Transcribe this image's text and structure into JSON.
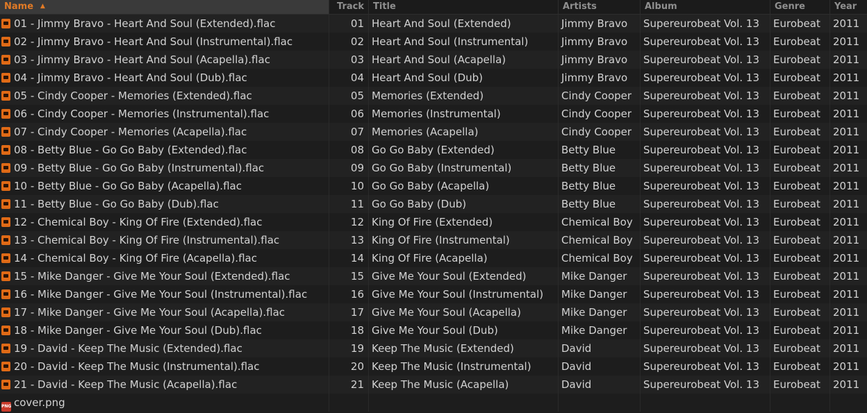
{
  "header": {
    "name": "Name",
    "track": "Track",
    "title": "Title",
    "artists": "Artists",
    "album": "Album",
    "genre": "Genre",
    "year": "Year",
    "sort_column": "Name",
    "sort_direction": "ascending",
    "sort_icon": "sort-up-icon"
  },
  "accent_color": "#e07a26",
  "files": [
    {
      "name": "01 - Jimmy Bravo - Heart And Soul (Extended).flac",
      "track": "01",
      "title": "Heart And Soul (Extended)",
      "artist": "Jimmy Bravo",
      "album": "Supereurobeat Vol. 13",
      "genre": "Eurobeat",
      "year": "2011"
    },
    {
      "name": "02 - Jimmy Bravo - Heart And Soul (Instrumental).flac",
      "track": "02",
      "title": "Heart And Soul (Instrumental)",
      "artist": "Jimmy Bravo",
      "album": "Supereurobeat Vol. 13",
      "genre": "Eurobeat",
      "year": "2011"
    },
    {
      "name": "03 - Jimmy Bravo - Heart And Soul (Acapella).flac",
      "track": "03",
      "title": "Heart And Soul (Acapella)",
      "artist": "Jimmy Bravo",
      "album": "Supereurobeat Vol. 13",
      "genre": "Eurobeat",
      "year": "2011"
    },
    {
      "name": "04 - Jimmy Bravo - Heart And Soul (Dub).flac",
      "track": "04",
      "title": "Heart And Soul (Dub)",
      "artist": "Jimmy Bravo",
      "album": "Supereurobeat Vol. 13",
      "genre": "Eurobeat",
      "year": "2011"
    },
    {
      "name": "05 - Cindy Cooper - Memories (Extended).flac",
      "track": "05",
      "title": "Memories (Extended)",
      "artist": "Cindy Cooper",
      "album": "Supereurobeat Vol. 13",
      "genre": "Eurobeat",
      "year": "2011"
    },
    {
      "name": "06 - Cindy Cooper - Memories (Instrumental).flac",
      "track": "06",
      "title": "Memories (Instrumental)",
      "artist": "Cindy Cooper",
      "album": "Supereurobeat Vol. 13",
      "genre": "Eurobeat",
      "year": "2011"
    },
    {
      "name": "07 - Cindy Cooper - Memories (Acapella).flac",
      "track": "07",
      "title": "Memories (Acapella)",
      "artist": "Cindy Cooper",
      "album": "Supereurobeat Vol. 13",
      "genre": "Eurobeat",
      "year": "2011"
    },
    {
      "name": "08 - Betty Blue - Go Go Baby (Extended).flac",
      "track": "08",
      "title": "Go Go Baby (Extended)",
      "artist": "Betty Blue",
      "album": "Supereurobeat Vol. 13",
      "genre": "Eurobeat",
      "year": "2011"
    },
    {
      "name": "09 - Betty Blue - Go Go Baby (Instrumental).flac",
      "track": "09",
      "title": "Go Go Baby (Instrumental)",
      "artist": "Betty Blue",
      "album": "Supereurobeat Vol. 13",
      "genre": "Eurobeat",
      "year": "2011"
    },
    {
      "name": "10 - Betty Blue - Go Go Baby (Acapella).flac",
      "track": "10",
      "title": "Go Go Baby (Acapella)",
      "artist": "Betty Blue",
      "album": "Supereurobeat Vol. 13",
      "genre": "Eurobeat",
      "year": "2011"
    },
    {
      "name": "11 - Betty Blue - Go Go Baby (Dub).flac",
      "track": "11",
      "title": "Go Go Baby (Dub)",
      "artist": "Betty Blue",
      "album": "Supereurobeat Vol. 13",
      "genre": "Eurobeat",
      "year": "2011"
    },
    {
      "name": "12 - Chemical Boy - King Of Fire (Extended).flac",
      "track": "12",
      "title": "King Of Fire (Extended)",
      "artist": "Chemical Boy",
      "album": "Supereurobeat Vol. 13",
      "genre": "Eurobeat",
      "year": "2011"
    },
    {
      "name": "13 - Chemical Boy - King Of Fire (Instrumental).flac",
      "track": "13",
      "title": "King Of Fire (Instrumental)",
      "artist": "Chemical Boy",
      "album": "Supereurobeat Vol. 13",
      "genre": "Eurobeat",
      "year": "2011"
    },
    {
      "name": "14 - Chemical Boy - King Of Fire (Acapella).flac",
      "track": "14",
      "title": "King Of Fire (Acapella)",
      "artist": "Chemical Boy",
      "album": "Supereurobeat Vol. 13",
      "genre": "Eurobeat",
      "year": "2011"
    },
    {
      "name": "15 - Mike Danger - Give Me Your Soul (Extended).flac",
      "track": "15",
      "title": "Give Me Your Soul (Extended)",
      "artist": "Mike Danger",
      "album": "Supereurobeat Vol. 13",
      "genre": "Eurobeat",
      "year": "2011"
    },
    {
      "name": "16 - Mike Danger - Give Me Your Soul (Instrumental).flac",
      "track": "16",
      "title": "Give Me Your Soul (Instrumental)",
      "artist": "Mike Danger",
      "album": "Supereurobeat Vol. 13",
      "genre": "Eurobeat",
      "year": "2011"
    },
    {
      "name": "17 - Mike Danger - Give Me Your Soul (Acapella).flac",
      "track": "17",
      "title": "Give Me Your Soul (Acapella)",
      "artist": "Mike Danger",
      "album": "Supereurobeat Vol. 13",
      "genre": "Eurobeat",
      "year": "2011"
    },
    {
      "name": "18 - Mike Danger - Give Me Your Soul (Dub).flac",
      "track": "18",
      "title": "Give Me Your Soul (Dub)",
      "artist": "Mike Danger",
      "album": "Supereurobeat Vol. 13",
      "genre": "Eurobeat",
      "year": "2011"
    },
    {
      "name": "19 - David - Keep The Music (Extended).flac",
      "track": "19",
      "title": "Keep The Music (Extended)",
      "artist": "David",
      "album": "Supereurobeat Vol. 13",
      "genre": "Eurobeat",
      "year": "2011"
    },
    {
      "name": "20 - David - Keep The Music (Instrumental).flac",
      "track": "20",
      "title": "Keep The Music (Instrumental)",
      "artist": "David",
      "album": "Supereurobeat Vol. 13",
      "genre": "Eurobeat",
      "year": "2011"
    },
    {
      "name": "21 - David - Keep The Music (Acapella).flac",
      "track": "21",
      "title": "Keep The Music (Acapella)",
      "artist": "David",
      "album": "Supereurobeat Vol. 13",
      "genre": "Eurobeat",
      "year": "2011"
    },
    {
      "name": "cover.png",
      "track": "",
      "title": "",
      "artist": "",
      "album": "",
      "genre": "",
      "year": "",
      "icon": "png-file-icon"
    }
  ],
  "icons": {
    "audio": "audio-file-icon",
    "image": "png-file-icon"
  }
}
